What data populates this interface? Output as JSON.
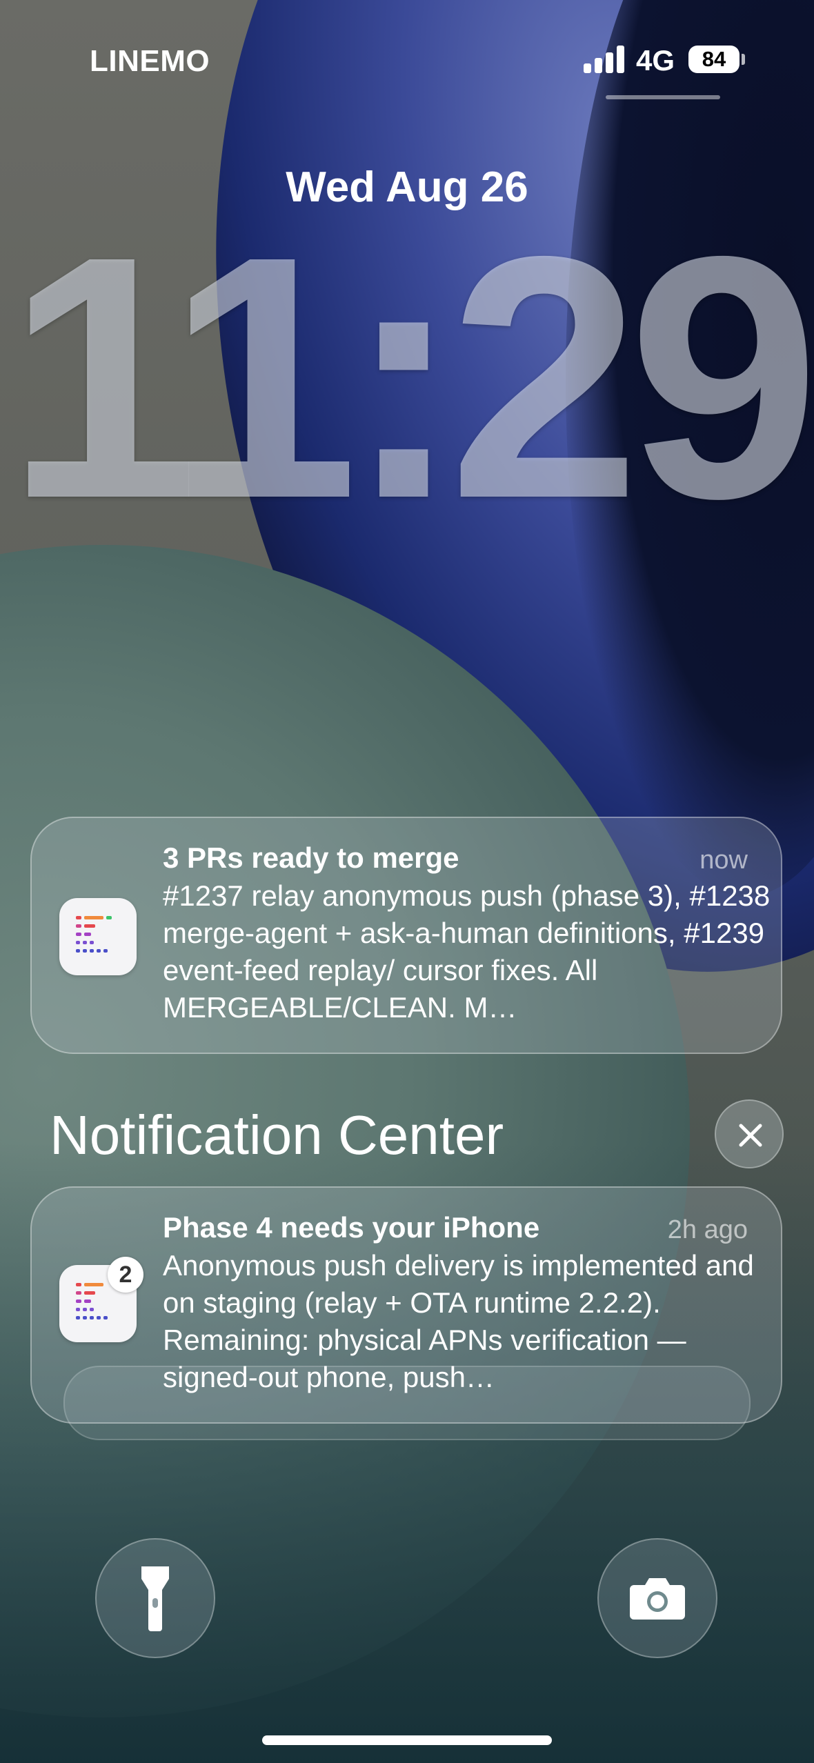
{
  "status_bar": {
    "carrier": "LINEMO",
    "network": "4G",
    "battery": "84",
    "signal_icon": "cellular-signal-icon"
  },
  "lock_screen": {
    "date": "Wed Aug 26",
    "time": "11:29"
  },
  "notifications": [
    {
      "title": "3 PRs ready to merge",
      "time": "now",
      "body": "#1237 relay anonymous push (phase 3), #1238 merge-agent + ask-a-human definitions, #1239 event-feed replay/ cursor fixes. All MERGEABLE/CLEAN. M…",
      "icon": "app-icon"
    }
  ],
  "notification_center": {
    "header": "Notification Center",
    "close_icon": "close-icon",
    "items": [
      {
        "title": "Phase 4 needs your iPhone",
        "time": "2h ago",
        "body": "Anonymous push delivery is implemented and on staging (relay + OTA runtime 2.2.2). Remaining: physical APNs verification — signed-out phone, push…",
        "badge": "2",
        "icon": "app-icon"
      }
    ]
  },
  "quick_actions": {
    "left_icon": "flashlight-icon",
    "right_icon": "camera-icon"
  }
}
